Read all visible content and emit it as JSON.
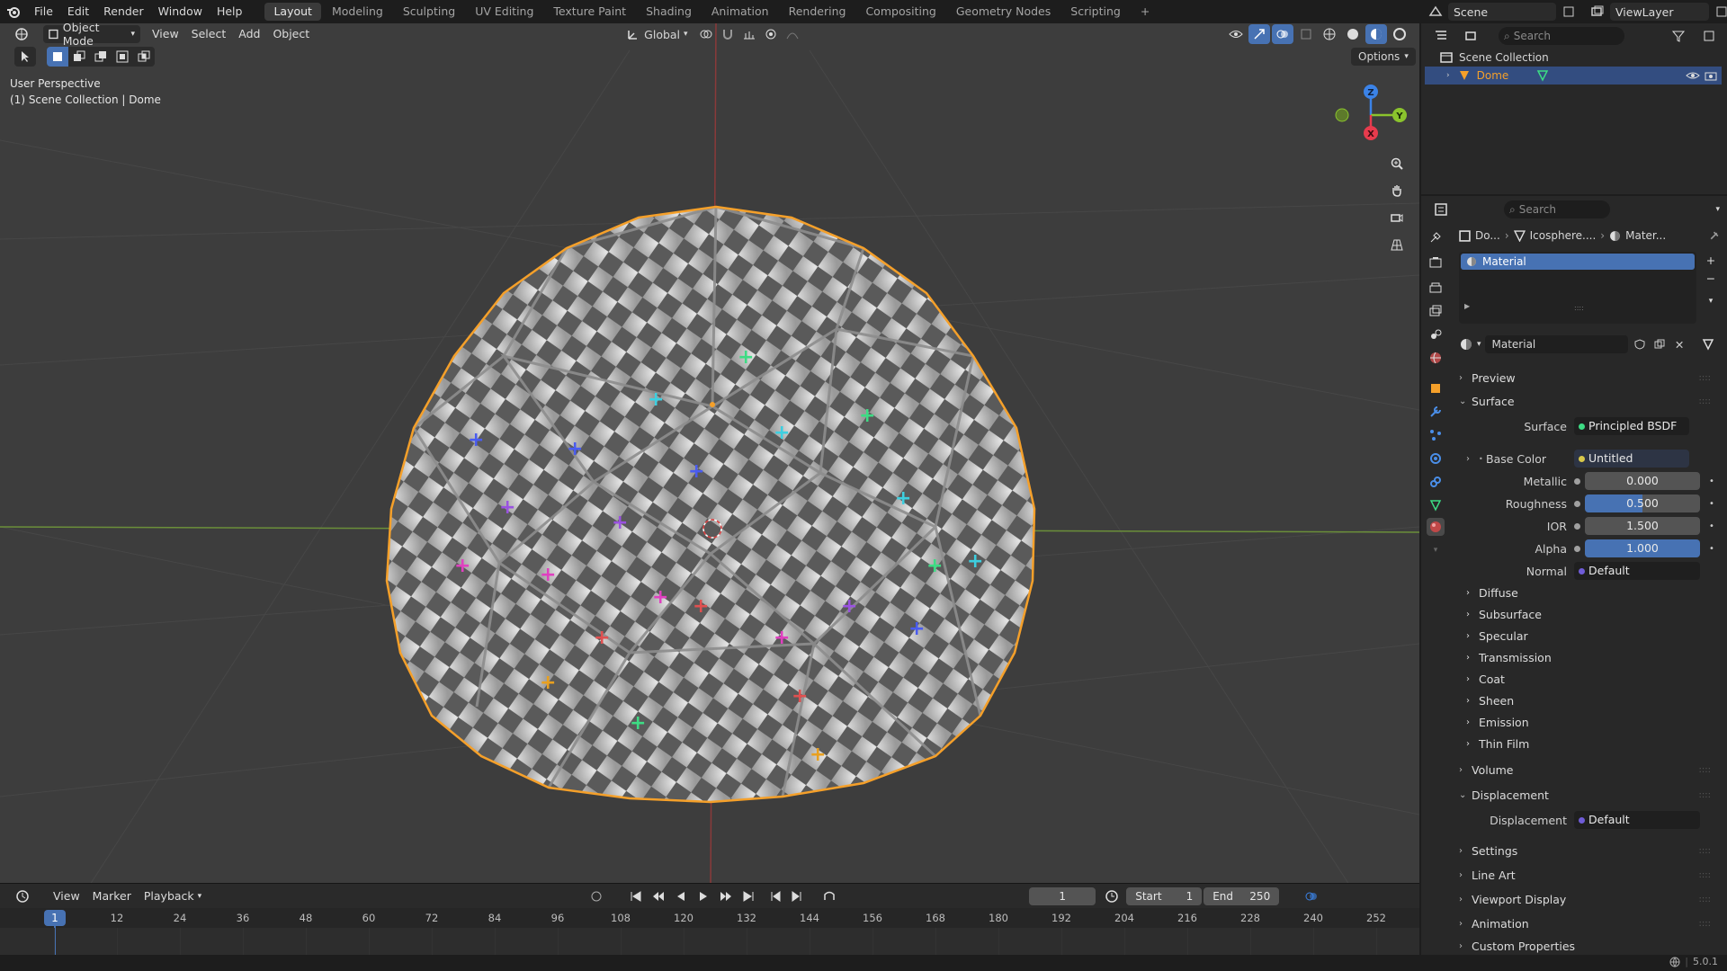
{
  "topbar": {
    "menus": [
      "File",
      "Edit",
      "Render",
      "Window",
      "Help"
    ],
    "workspaces": [
      "Layout",
      "Modeling",
      "Sculpting",
      "UV Editing",
      "Texture Paint",
      "Shading",
      "Animation",
      "Rendering",
      "Compositing",
      "Geometry Nodes",
      "Scripting"
    ],
    "active_workspace": "Layout",
    "add_tab": "+",
    "scene": "Scene",
    "view_layer": "ViewLayer"
  },
  "viewport": {
    "mode": "Object Mode",
    "menus": [
      "View",
      "Select",
      "Add",
      "Object"
    ],
    "orientation": "Global",
    "options": "Options",
    "overlay_title": "User Perspective",
    "overlay_subtitle": "(1) Scene Collection | Dome",
    "gizmo": {
      "z": "Z",
      "y": "Y",
      "x": "X"
    }
  },
  "timeline": {
    "menus": [
      "View",
      "Marker",
      "Playback"
    ],
    "current_frame": "1",
    "start_label": "Start",
    "start": "1",
    "end_label": "End",
    "end": "250",
    "ticks": [
      "1",
      "12",
      "24",
      "36",
      "48",
      "60",
      "72",
      "84",
      "96",
      "108",
      "120",
      "132",
      "144",
      "156",
      "168",
      "180",
      "192",
      "204",
      "216",
      "228",
      "240",
      "252"
    ],
    "playhead": "1"
  },
  "outliner": {
    "search_placeholder": "Search",
    "collection": "Scene Collection",
    "object": "Dome"
  },
  "properties": {
    "search_placeholder": "Search",
    "breadcrumb": [
      "Do...",
      "Icosphere....",
      "Mater..."
    ],
    "slot": "Material",
    "material_name": "Material",
    "sections_top": [
      "Preview"
    ],
    "surface_section": "Surface",
    "surface_label": "Surface",
    "surface_value": "Principled BSDF",
    "base_color_label": "Base Color",
    "base_color_value": "Untitled",
    "metallic_label": "Metallic",
    "metallic": "0.000",
    "roughness_label": "Roughness",
    "roughness": "0.500",
    "ior_label": "IOR",
    "ior": "1.500",
    "alpha_label": "Alpha",
    "alpha": "1.000",
    "normal_label": "Normal",
    "normal_value": "Default",
    "subpanels": [
      "Diffuse",
      "Subsurface",
      "Specular",
      "Transmission",
      "Coat",
      "Sheen",
      "Emission",
      "Thin Film"
    ],
    "volume": "Volume",
    "displacement_section": "Displacement",
    "displacement_label": "Displacement",
    "displacement_value": "Default",
    "sections_bottom": [
      "Settings",
      "Line Art",
      "Viewport Display",
      "Animation",
      "Custom Properties"
    ]
  },
  "status": {
    "version": "5.0.1"
  },
  "colors": {
    "accent": "#4772b3",
    "selection": "#f5a02a",
    "x_axis": "#e83b4d",
    "y_axis": "#8bc42d",
    "z_axis": "#3b83e8"
  }
}
